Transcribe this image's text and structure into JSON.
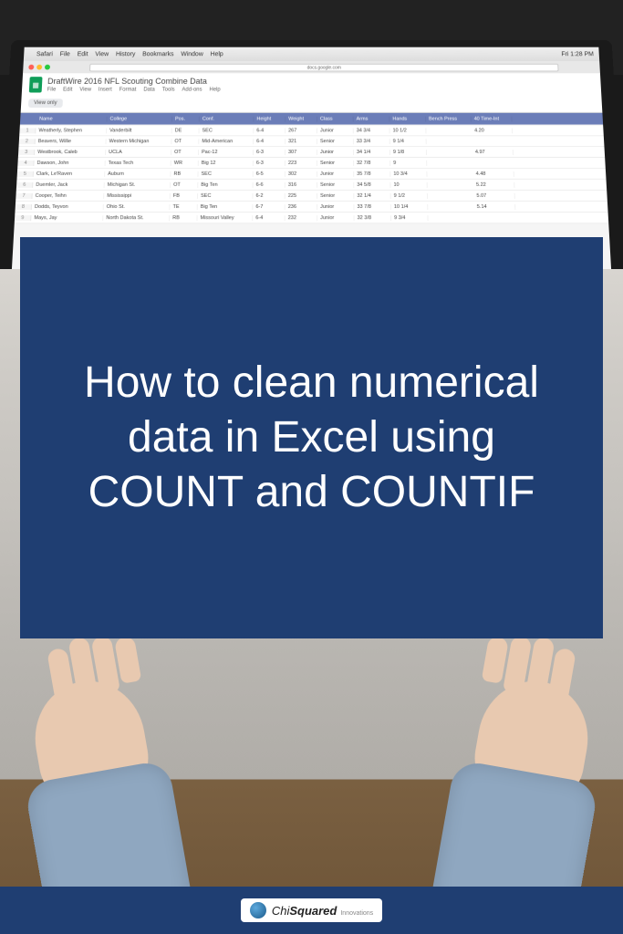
{
  "mac_menu": {
    "apple": "",
    "items": [
      "Safari",
      "File",
      "Edit",
      "View",
      "History",
      "Bookmarks",
      "Window",
      "Help"
    ],
    "right": [
      "Fri 1:28 PM"
    ]
  },
  "browser": {
    "url": "docs.google.com"
  },
  "sheet": {
    "title": "DraftWire 2016 NFL Scouting Combine Data",
    "menu": [
      "File",
      "Edit",
      "View",
      "Insert",
      "Format",
      "Data",
      "Tools",
      "Add-ons",
      "Help"
    ],
    "view_only": "View only",
    "columns": [
      "Name",
      "College",
      "Pos.",
      "Conf.",
      "Height",
      "Weight",
      "Class",
      "Arms",
      "Hands",
      "Bench Press",
      "40 Time-Int"
    ],
    "rows": [
      {
        "n": "1",
        "name": "Weatherly, Stephen",
        "col": "Vanderbilt",
        "pos": "DE",
        "conf": "SEC",
        "h": "6-4",
        "w": "267",
        "cls": "Junior",
        "arm": "34 3/4",
        "hand": "10 1/2",
        "bp": "",
        "t": "4.20"
      },
      {
        "n": "2",
        "name": "Beavers, Willie",
        "col": "Western Michigan",
        "pos": "OT",
        "conf": "Mid-American",
        "h": "6-4",
        "w": "321",
        "cls": "Senior",
        "arm": "33 3/4",
        "hand": "9 1/4",
        "bp": "",
        "t": ""
      },
      {
        "n": "3",
        "name": "Westbrook, Caleb",
        "col": "UCLA",
        "pos": "OT",
        "conf": "Pac-12",
        "h": "6-3",
        "w": "307",
        "cls": "Junior",
        "arm": "34 1/4",
        "hand": "9 1/8",
        "bp": "",
        "t": "4.97"
      },
      {
        "n": "4",
        "name": "Dawson, John",
        "col": "Texas Tech",
        "pos": "WR",
        "conf": "Big 12",
        "h": "6-3",
        "w": "223",
        "cls": "Senior",
        "arm": "32 7/8",
        "hand": "9",
        "bp": "",
        "t": ""
      },
      {
        "n": "5",
        "name": "Clark, Le'Raven",
        "col": "Auburn",
        "pos": "RB",
        "conf": "SEC",
        "h": "6-5",
        "w": "302",
        "cls": "Junior",
        "arm": "35 7/8",
        "hand": "10 3/4",
        "bp": "",
        "t": "4.48"
      },
      {
        "n": "6",
        "name": "Duemler, Jack",
        "col": "Michigan St.",
        "pos": "OT",
        "conf": "Big Ten",
        "h": "6-6",
        "w": "316",
        "cls": "Senior",
        "arm": "34 5/8",
        "hand": "10",
        "bp": "",
        "t": "5.22"
      },
      {
        "n": "7",
        "name": "Cooper, Teihn",
        "col": "Mississippi",
        "pos": "FB",
        "conf": "SEC",
        "h": "6-2",
        "w": "225",
        "cls": "Senior",
        "arm": "32 1/4",
        "hand": "9 1/2",
        "bp": "",
        "t": "5.07"
      },
      {
        "n": "8",
        "name": "Dodds, Teyvon",
        "col": "Ohio St.",
        "pos": "TE",
        "conf": "Big Ten",
        "h": "6-7",
        "w": "236",
        "cls": "Junior",
        "arm": "33 7/8",
        "hand": "10 1/4",
        "bp": "",
        "t": "5.14"
      },
      {
        "n": "9",
        "name": "Mays, Jay",
        "col": "North Dakota St.",
        "pos": "RB",
        "conf": "Missouri Valley",
        "h": "6-4",
        "w": "232",
        "cls": "Junior",
        "arm": "32 3/8",
        "hand": "9 3/4",
        "bp": "",
        "t": ""
      }
    ]
  },
  "title": "How to clean numerical data in Excel using COUNT and COUNTIF",
  "brand": {
    "name_part1": "Chi",
    "name_part2": "Squared",
    "tagline": "Innovations"
  }
}
